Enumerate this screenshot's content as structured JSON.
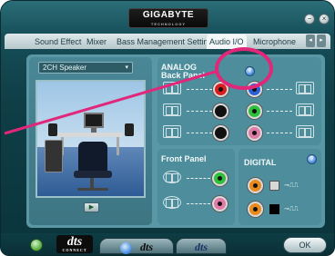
{
  "window": {
    "brand": "GIGABYTE",
    "brand_sub": "TECHNOLOGY",
    "minimize_glyph": "−",
    "close_glyph": "×"
  },
  "tabs": [
    {
      "label": "Sound Effect",
      "active": false
    },
    {
      "label": "Mixer",
      "active": false
    },
    {
      "label": "Bass Management Setting",
      "active": false
    },
    {
      "label": "Audio I/O",
      "active": true
    },
    {
      "label": "Microphone",
      "active": false
    }
  ],
  "tab_nav": {
    "prev": "◂",
    "next": "▸"
  },
  "speaker_select": {
    "value": "2CH Speaker",
    "caret": "▾"
  },
  "analog": {
    "title": "ANALOG",
    "subtitle": "Back Panel",
    "help": "?"
  },
  "front_panel": {
    "title": "Front Panel"
  },
  "digital": {
    "title": "DIGITAL",
    "help": "?"
  },
  "play_button": {
    "glyph": "▶"
  },
  "bottom": {
    "dts_logo": "dts",
    "dts_logo_sub": "CONNECT",
    "dts_button_1": "dts",
    "dts_button_2": "dts",
    "ok_label": "OK"
  },
  "colors": {
    "annotation": "#e0277a",
    "jack_red": "#d81f1f",
    "jack_blue": "#2b5fd8",
    "jack_black": "#111111",
    "jack_green": "#2fbf3a",
    "jack_orange": "#e88a1c",
    "jack_gray": "#7a7a7a",
    "jack_pink": "#e07aa7"
  }
}
